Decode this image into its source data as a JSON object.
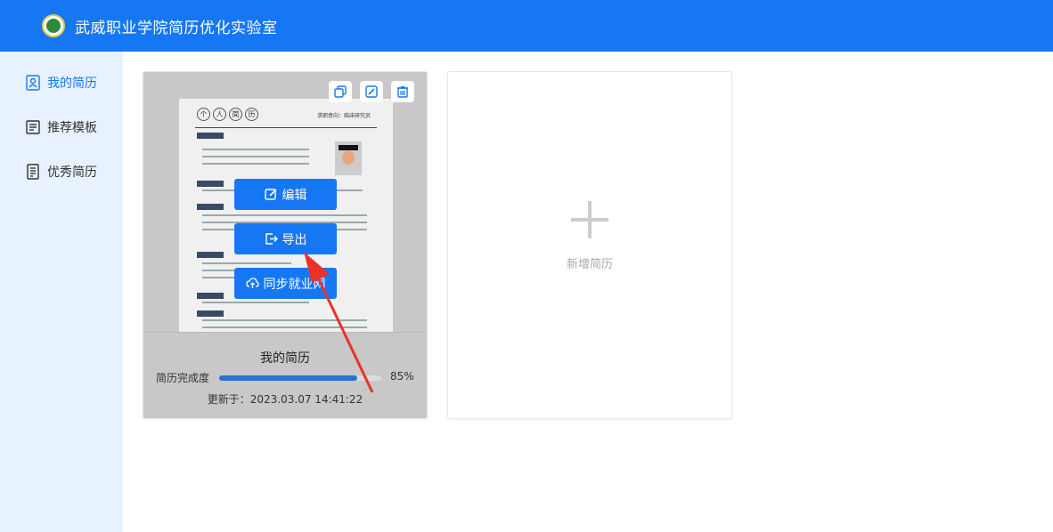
{
  "header": {
    "title": "武威职业学院简历优化实验室"
  },
  "sidebar": {
    "items": [
      {
        "label": "我的简历",
        "icon": "user-profile-icon",
        "active": true
      },
      {
        "label": "推荐模板",
        "icon": "template-icon",
        "active": false
      },
      {
        "label": "优秀简历",
        "icon": "document-list-icon",
        "active": false
      }
    ]
  },
  "resume_card": {
    "name": "我的简历",
    "progress_label": "简历完成度",
    "progress_percent": 85,
    "progress_text": "85%",
    "updated": "更新于：2023.03.07 14:41:22",
    "actions": {
      "edit": "编辑",
      "export": "导出",
      "sync": "同步就业网"
    },
    "preview": {
      "chars": [
        "个",
        "人",
        "简",
        "历"
      ],
      "job_intent": "求职意向：临床研究员"
    }
  },
  "new_card": {
    "label": "新增简历"
  },
  "colors": {
    "primary": "#1677f5",
    "sidebar_bg": "#e8f2ff",
    "arrow": "#e8332b"
  }
}
